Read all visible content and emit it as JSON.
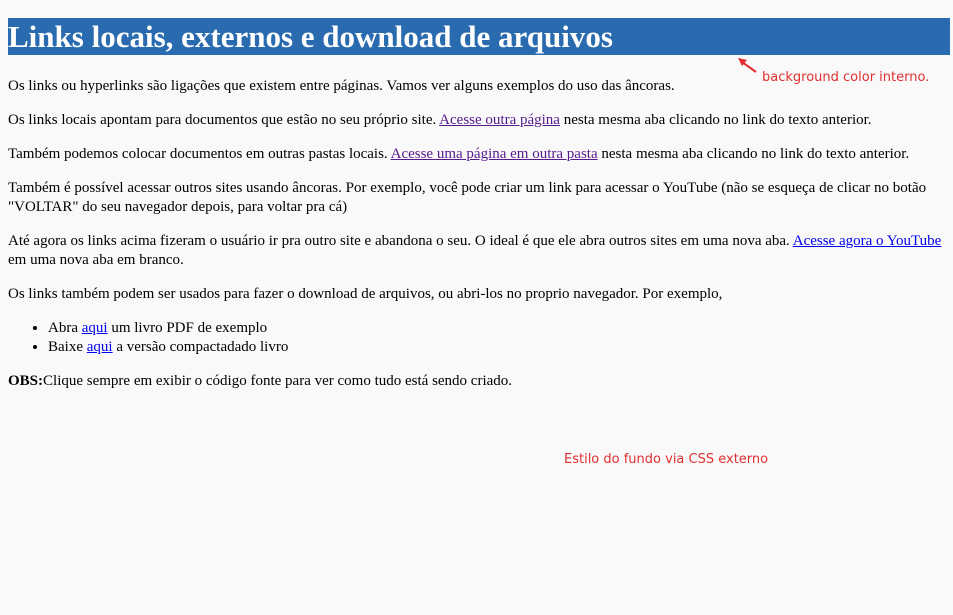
{
  "page": {
    "title": "Links locais, externos e download de arquivos",
    "intro": "Os links ou hyperlinks são ligações que existem entre páginas. Vamos ver alguns exemplos do uso das âncoras.",
    "local": {
      "before": "Os links locais apontam para documentos que estão no seu próprio site. ",
      "link": "Acesse outra página",
      "after": " nesta mesma aba clicando no link do texto anterior."
    },
    "folder": {
      "before": "Também podemos colocar documentos em outras pastas locais. ",
      "link": "Acesse uma página em outra pasta",
      "after": " nesta mesma aba clicando no link do texto anterior."
    },
    "external": "Também é possível acessar outros sites usando âncoras. Por exemplo, você pode criar um link para acessar o YouTube (não se esqueça de clicar no botão \"VOLTAR\" do seu navegador depois, para voltar pra cá)",
    "newtab": {
      "before": "Até agora os links acima fizeram o usuário ir pra outro site e abandona o seu. O ideal é que ele abra outros sites em uma nova aba. ",
      "link": "Acesse agora o YouTube",
      "after": " em uma nova aba em branco."
    },
    "download_intro": "Os links também podem ser usados para fazer o download de arquivos, ou abri-los no proprio navegador. Por exemplo,",
    "downloads": [
      {
        "before": "Abra ",
        "link": "aqui",
        "after": " um livro PDF de exemplo"
      },
      {
        "before": "Baixe ",
        "link": "aqui",
        "after": " a versão compactadado livro"
      }
    ],
    "obs": {
      "label": "OBS:",
      "text": "Clique sempre em exibir o código fonte para ver como tudo está sendo criado."
    }
  },
  "annotations": {
    "bg_color": "background color interno.",
    "css_bg": "Estilo do fundo via CSS externo"
  },
  "colors": {
    "header_bg": "#2a6bb0",
    "page_bg": "#f9f9fa",
    "annotation": "#e03030",
    "link": "#0000ee",
    "visited_link": "#551a8b"
  }
}
